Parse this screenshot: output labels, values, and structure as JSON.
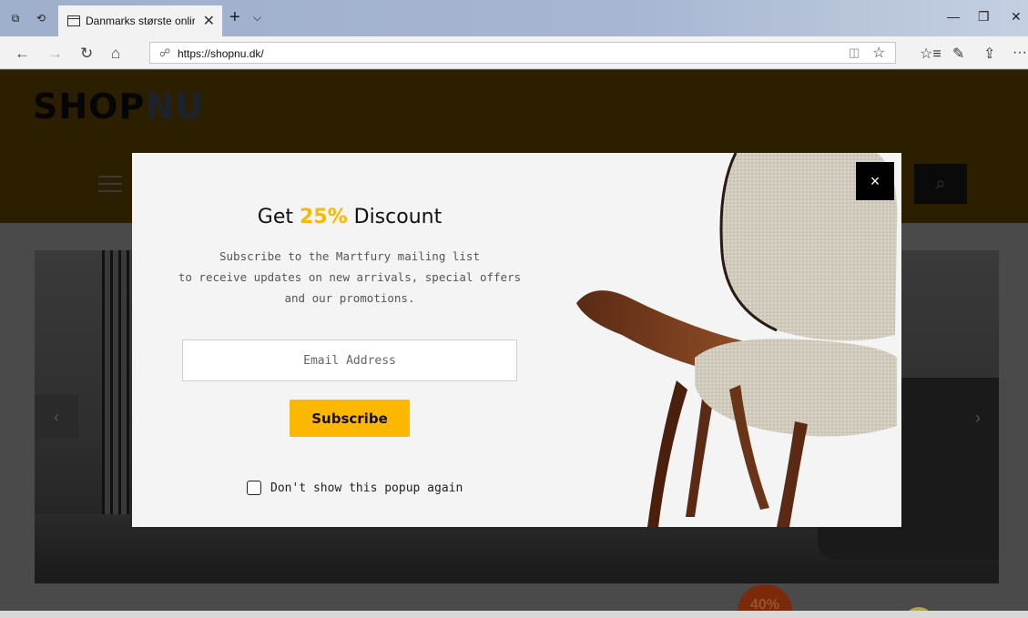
{
  "browser": {
    "tab_title": "Danmarks største onlir",
    "tab_close": "✕",
    "new_tab": "+",
    "tab_dropdown": "⌵",
    "url": "https://shopnu.dk/",
    "window_minimize": "—",
    "window_restore": "❐",
    "window_close": "✕",
    "back": "←",
    "forward": "→",
    "refresh": "↻",
    "home": "⌂",
    "lock_icon": "🔒",
    "reading_icon": "📖",
    "favorite_icon": "☆",
    "favorites_bar_icon": "☆≡",
    "pen_icon": "✎",
    "share_icon": "⇪",
    "more_icon": "···",
    "set_tabs_aside_icon": "⧉",
    "tab_history_icon": "⟲"
  },
  "page": {
    "logo_part1": "SHOP",
    "logo_part2": "NU",
    "search_icon": "⌕",
    "slider_prev": "‹",
    "slider_next": "›",
    "sale_badge": "40%"
  },
  "modal": {
    "title_pre": "Get ",
    "title_highlight": "25%",
    "title_post": " Discount",
    "desc_line1": "Subscribe to the Martfury mailing list",
    "desc_line2": "to receive updates on new arrivals, special offers",
    "desc_line3": "and our promotions.",
    "email_placeholder": "Email Address",
    "subscribe_label": "Subscribe",
    "checkbox_label": "Don't show this popup again",
    "close_label": "×"
  },
  "colors": {
    "accent": "#fcb800",
    "header_bg": "#2c1f00",
    "modal_bg": "#f4f4f4"
  }
}
